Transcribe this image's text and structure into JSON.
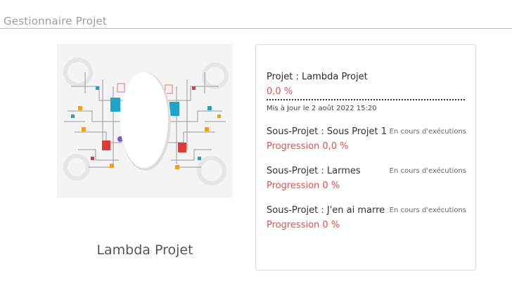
{
  "header": {
    "title": "Gestionnaire Projet"
  },
  "project": {
    "name": "Lambda Projet",
    "image_alt": "network-illustration"
  },
  "card": {
    "title": "Projet : Lambda Projet",
    "progress": "0,0 %",
    "updated": "Mis à Jour le 2 août 2022 15:20",
    "subprojects": [
      {
        "name": "Sous-Projet : Sous Projet 1",
        "status": "En cours d'exécutions",
        "progress": "Progression 0,0 %"
      },
      {
        "name": "Sous-Projet : Larmes",
        "status": "En cours d'exécutions",
        "progress": "Progression 0 %"
      },
      {
        "name": "Sous-Projet : J'en ai marre",
        "status": "En cours d'exécutions",
        "progress": "Progression 0 %"
      }
    ]
  },
  "colors": {
    "accent_red": "#d9534f",
    "header_text": "#9c9c9c",
    "border": "#d9d9d9"
  }
}
